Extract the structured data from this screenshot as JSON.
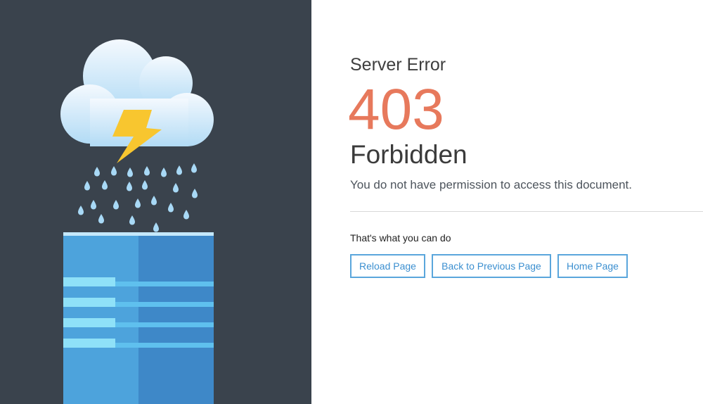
{
  "error": {
    "eyebrow": "Server Error",
    "code": "403",
    "title": "Forbidden",
    "message": "You do not have permission to access this document."
  },
  "actions": {
    "heading": "That's what you can do",
    "buttons": {
      "reload": "Reload Page",
      "back": "Back to Previous Page",
      "home": "Home Page"
    }
  },
  "illustration": {
    "icons": [
      "cloud-icon",
      "lightning-bolt-icon",
      "raindrop-icon",
      "server-icon"
    ]
  },
  "colors": {
    "panel_bg": "#3a434d",
    "accent_code": "#e7795c",
    "button_border": "#5aa6dc",
    "button_text": "#3b8fd0",
    "bolt": "#f8c62f",
    "cloud_top": "#f4f9fe",
    "cloud_bottom": "#b2dbf5",
    "raindrop": "#a8d9f6",
    "server_light": "#4da3dc",
    "server_dark": "#3e88c8",
    "server_stripe": "#8fe1f8"
  }
}
